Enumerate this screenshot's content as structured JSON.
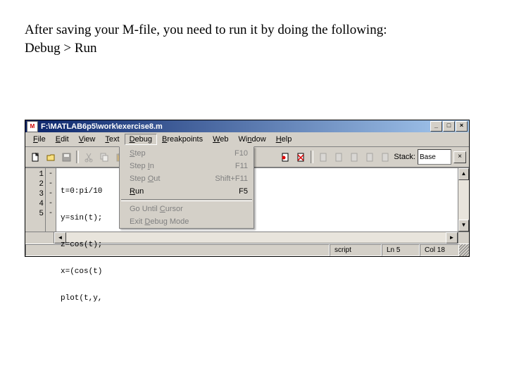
{
  "instruction": {
    "line1": "After saving your M-file, you need to run it by doing the following:",
    "line2": "Debug > Run"
  },
  "window": {
    "title": "F:\\MATLAB6p5\\work\\exercise8.m",
    "icon_char": "M"
  },
  "menubar": [
    {
      "label": "File",
      "accel": "F"
    },
    {
      "label": "Edit",
      "accel": "E"
    },
    {
      "label": "View",
      "accel": "V"
    },
    {
      "label": "Text",
      "accel": "T"
    },
    {
      "label": "Debug",
      "accel": "D",
      "active": true
    },
    {
      "label": "Breakpoints",
      "accel": "B"
    },
    {
      "label": "Web",
      "accel": "W"
    },
    {
      "label": "Window",
      "accel": "n"
    },
    {
      "label": "Help",
      "accel": "H"
    }
  ],
  "toolbar": {
    "stack_label": "Stack:",
    "stack_value": "Base"
  },
  "debug_menu": [
    {
      "label": "Step",
      "accel": "S",
      "shortcut": "F10",
      "enabled": false
    },
    {
      "label": "Step In",
      "accel": "I",
      "shortcut": "F11",
      "enabled": false
    },
    {
      "label": "Step Out",
      "accel": "O",
      "shortcut": "Shift+F11",
      "enabled": false
    },
    {
      "label": "Run",
      "accel": "R",
      "shortcut": "F5",
      "enabled": true
    },
    {
      "sep": true
    },
    {
      "label": "Go Until Cursor",
      "accel": "C",
      "shortcut": "",
      "enabled": false
    },
    {
      "label": "Exit Debug Mode",
      "accel": "D",
      "shortcut": "",
      "enabled": false
    }
  ],
  "editor": {
    "gutter": [
      "1",
      "2",
      "3",
      "4",
      "5"
    ],
    "bp": [
      "-",
      "-",
      "-",
      "-",
      "-"
    ],
    "code": [
      "t=0:pi/10",
      "y=sin(t);",
      "z=cos(t);",
      "x=(cos(t)",
      "plot(t,y,"
    ]
  },
  "statusbar": {
    "mode": "script",
    "line": "Ln 5",
    "col": "Col 18"
  }
}
